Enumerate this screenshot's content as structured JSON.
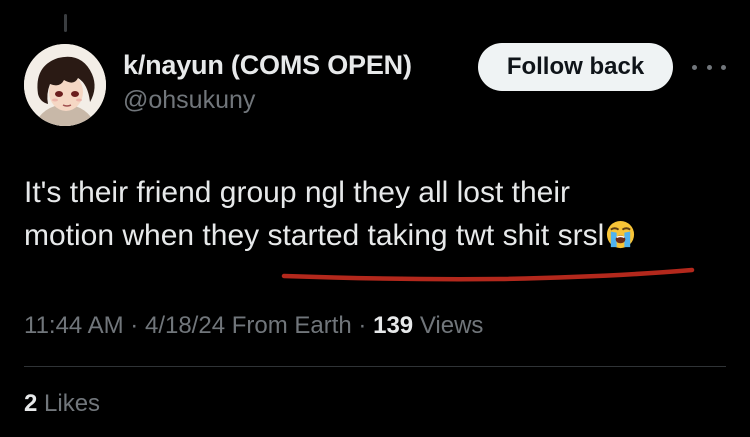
{
  "author": {
    "display_name": "k/nayun (COMS OPEN)",
    "handle": "@ohsukuny",
    "avatar_icon": "anime-avatar"
  },
  "actions": {
    "follow_label": "Follow back",
    "more_icon": "more-horizontal-icon"
  },
  "tweet": {
    "line1": "It's their friend group ngl they all lost their",
    "line2": "motion when they started taking twt shit srsl",
    "emoji": "loudly-crying-face"
  },
  "meta": {
    "time": "11:44 AM",
    "separator": "·",
    "date": "4/18/24",
    "source": "From Earth",
    "views_count": "139",
    "views_label": "Views"
  },
  "engagement": {
    "likes_count": "2",
    "likes_label": "Likes"
  },
  "colors": {
    "background": "#000000",
    "primary_text": "#e7e9ea",
    "secondary_text": "#71767b",
    "follow_button_bg": "#eff3f4",
    "annotation_red": "#b3281c"
  }
}
